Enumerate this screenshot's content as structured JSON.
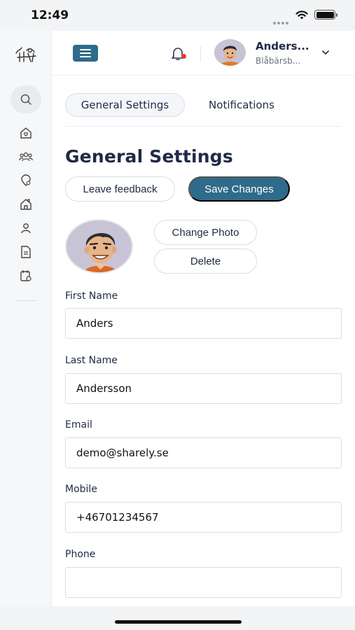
{
  "status": {
    "time": "12:49"
  },
  "header": {
    "user_name": "Anders...",
    "user_org": "Blåbärsb..."
  },
  "sidebar": {
    "items": [
      {
        "icon": "home-heart-icon"
      },
      {
        "icon": "users-group-icon"
      },
      {
        "icon": "location-heart-icon"
      },
      {
        "icon": "house-icon"
      },
      {
        "icon": "person-icon"
      },
      {
        "icon": "document-icon"
      },
      {
        "icon": "calendar-home-icon"
      }
    ]
  },
  "tabs": [
    {
      "label": "General Settings",
      "active": true
    },
    {
      "label": "Notifications",
      "active": false
    }
  ],
  "page": {
    "title": "General Settings",
    "leave_feedback_label": "Leave feedback",
    "save_label": "Save Changes",
    "change_photo_label": "Change Photo",
    "delete_label": "Delete"
  },
  "form": {
    "first_name": {
      "label": "First Name",
      "value": "Anders"
    },
    "last_name": {
      "label": "Last Name",
      "value": "Andersson"
    },
    "email": {
      "label": "Email",
      "value": "demo@sharely.se"
    },
    "mobile": {
      "label": "Mobile",
      "value": "+46701234567"
    },
    "phone": {
      "label": "Phone",
      "value": ""
    }
  },
  "colors": {
    "accent": "#2f6b8a",
    "notification_dot": "#e33a3a",
    "text": "#1f2a44"
  }
}
